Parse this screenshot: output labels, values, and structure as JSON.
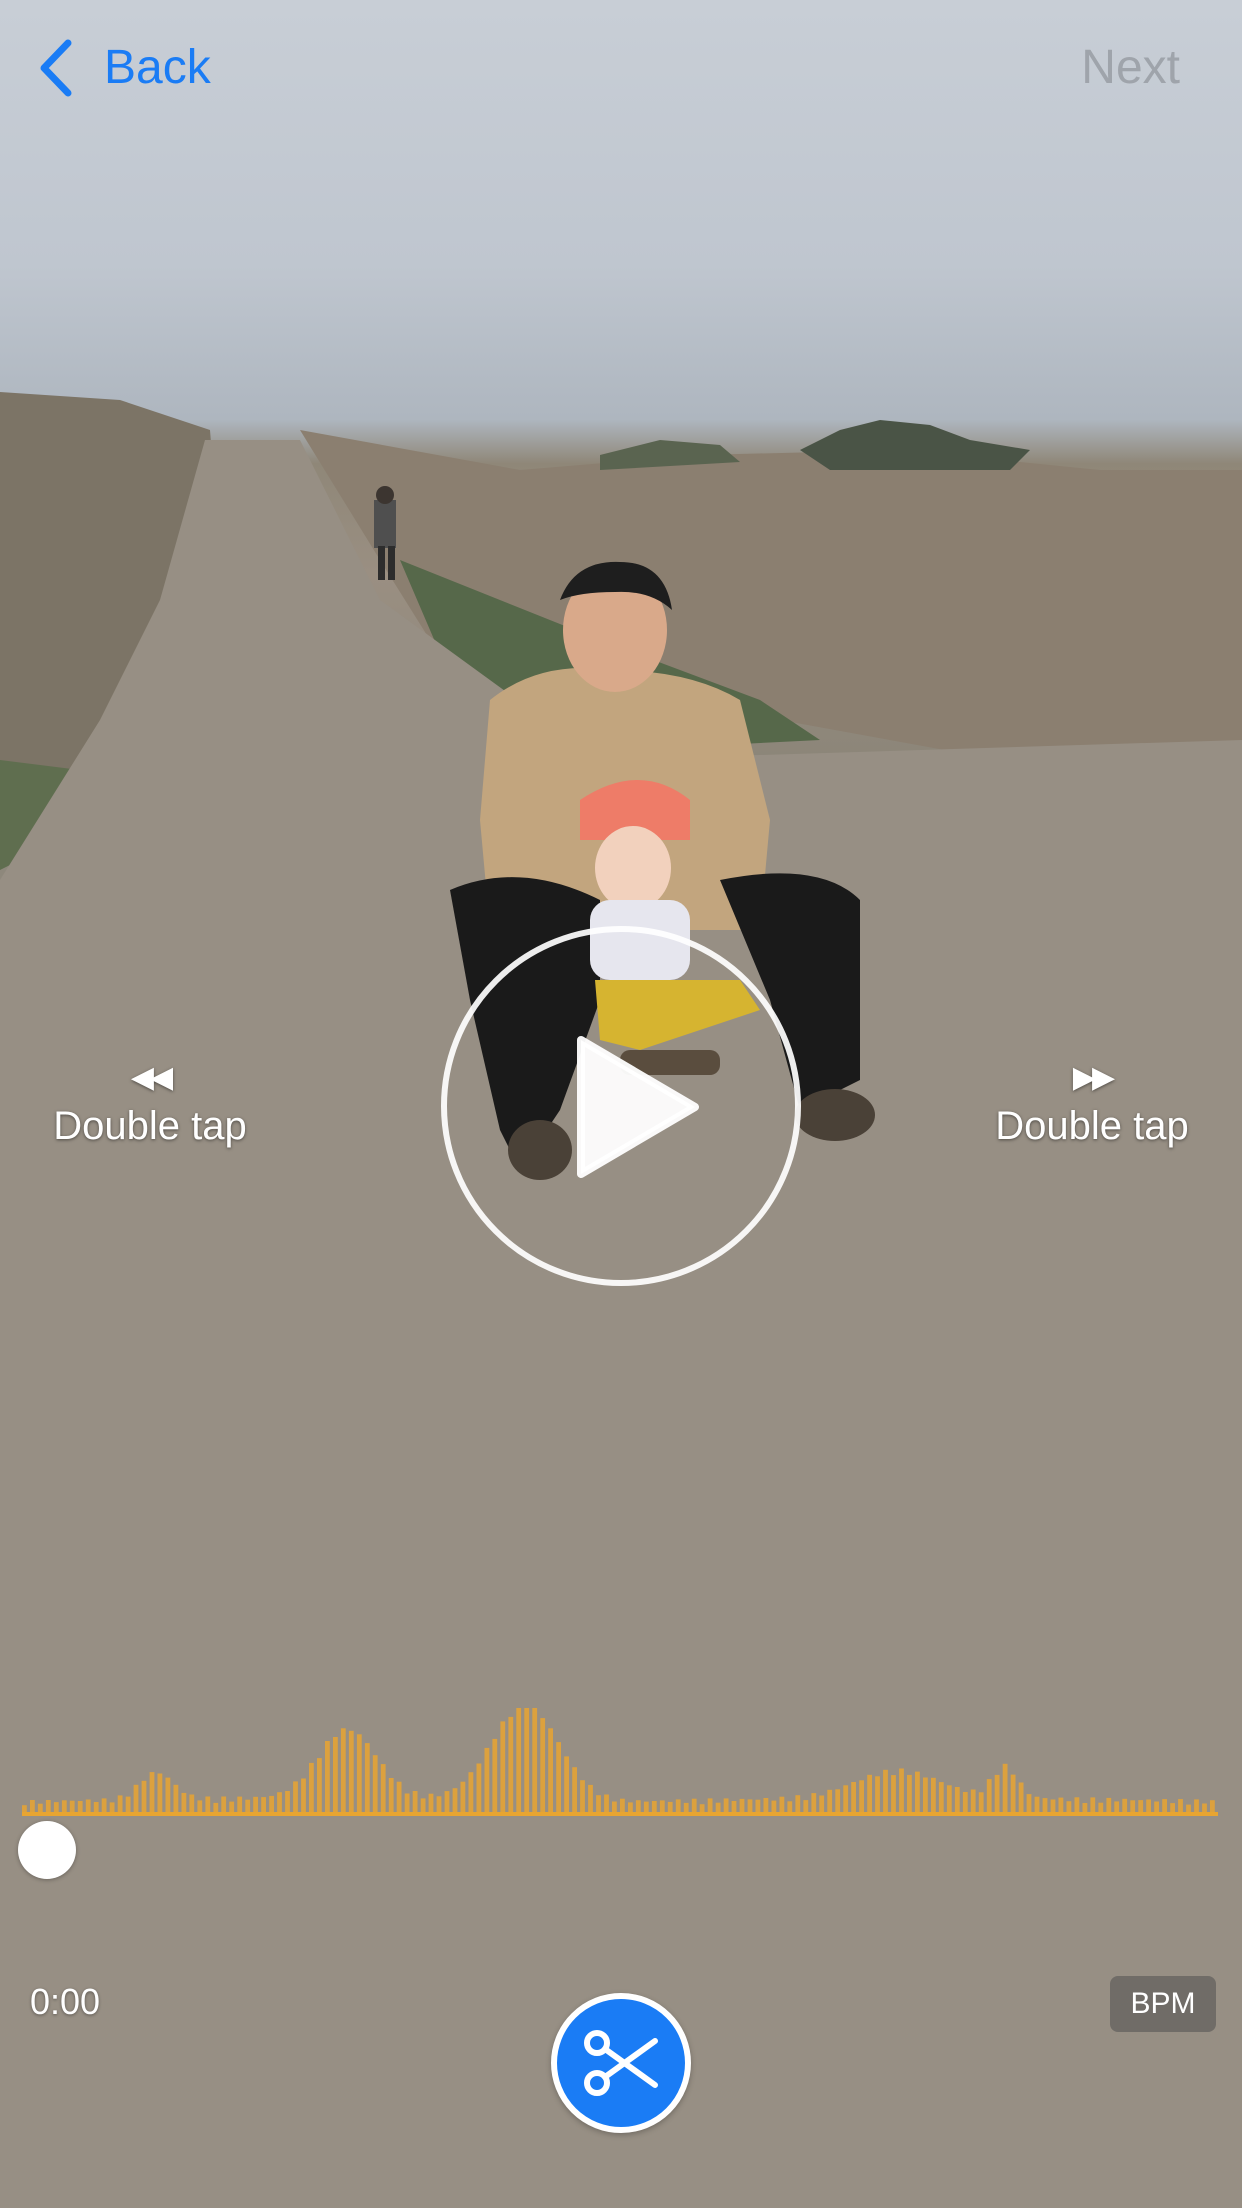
{
  "nav": {
    "back_label": "Back",
    "next_label": "Next"
  },
  "seek": {
    "rewind_arrows": "◀◀",
    "rewind_label": "Double tap",
    "forward_arrows": "▶▶",
    "forward_label": "Double tap"
  },
  "player": {
    "state": "paused",
    "current_time": "0:00",
    "progress": 0.0
  },
  "bpm_label": "BPM",
  "colors": {
    "accent": "#1a7cf5",
    "waveform": "#e8a531",
    "next_disabled": "#9fa4ab"
  },
  "icons": {
    "back": "chevron-left-icon",
    "play": "play-icon",
    "cut": "scissors-icon"
  }
}
